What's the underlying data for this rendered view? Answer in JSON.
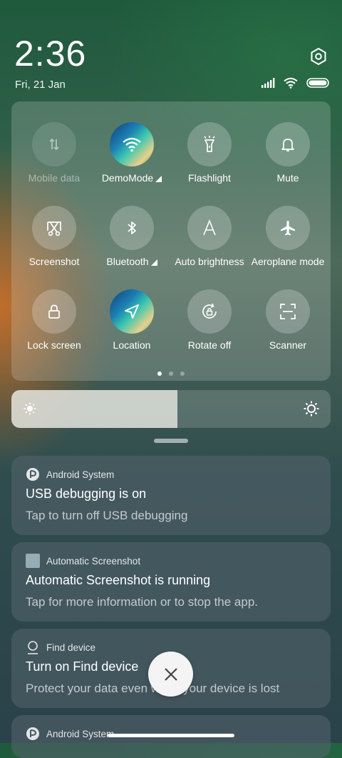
{
  "status_bar": {
    "time": "2:36",
    "date": "Fri, 21 Jan"
  },
  "quick_settings": {
    "tiles": [
      {
        "name": "mobile-data",
        "label": "Mobile data",
        "icon": "mobile-data-icon",
        "state": "disabled"
      },
      {
        "name": "demomode",
        "label": "DemoMode",
        "icon": "wifi-icon",
        "state": "on",
        "has_menu": true
      },
      {
        "name": "flashlight",
        "label": "Flashlight",
        "icon": "flashlight-icon",
        "state": "off"
      },
      {
        "name": "mute",
        "label": "Mute",
        "icon": "bell-icon",
        "state": "off"
      },
      {
        "name": "screenshot",
        "label": "Screenshot",
        "icon": "scissors-icon",
        "state": "off"
      },
      {
        "name": "bluetooth",
        "label": "Bluetooth",
        "icon": "bluetooth-icon",
        "state": "off",
        "has_menu": true
      },
      {
        "name": "auto-brightness",
        "label": "Auto brightness",
        "icon": "auto-brightness-icon",
        "state": "off"
      },
      {
        "name": "aeroplane-mode",
        "label": "Aeroplane mode",
        "icon": "airplane-icon",
        "state": "off"
      },
      {
        "name": "lock-screen",
        "label": "Lock screen",
        "icon": "lock-icon",
        "state": "off"
      },
      {
        "name": "location",
        "label": "Location",
        "icon": "location-icon",
        "state": "on"
      },
      {
        "name": "rotate-off",
        "label": "Rotate off",
        "icon": "rotation-lock-icon",
        "state": "off"
      },
      {
        "name": "scanner",
        "label": "Scanner",
        "icon": "scanner-icon",
        "state": "off"
      }
    ],
    "page_count": 3,
    "current_page": 1
  },
  "brightness": {
    "level": 0.52
  },
  "notifications": [
    {
      "app": "Android System",
      "app_icon": "android-system-icon",
      "title": "USB debugging is on",
      "body": "Tap to turn off USB debugging"
    },
    {
      "app": "Automatic Screenshot",
      "app_icon": "automatic-screenshot-icon",
      "title": "Automatic Screenshot is running",
      "body": "Tap for more information or to stop the app."
    },
    {
      "app": "Find device",
      "app_icon": "find-device-icon",
      "title": "Turn on Find device",
      "body": "Protect your data even when your device is lost"
    },
    {
      "app": "Android System",
      "app_icon": "android-system-icon"
    }
  ],
  "colors": {
    "panel": "#dce1dc",
    "notification": "#55646e",
    "close_button": "#f4f4f4"
  }
}
